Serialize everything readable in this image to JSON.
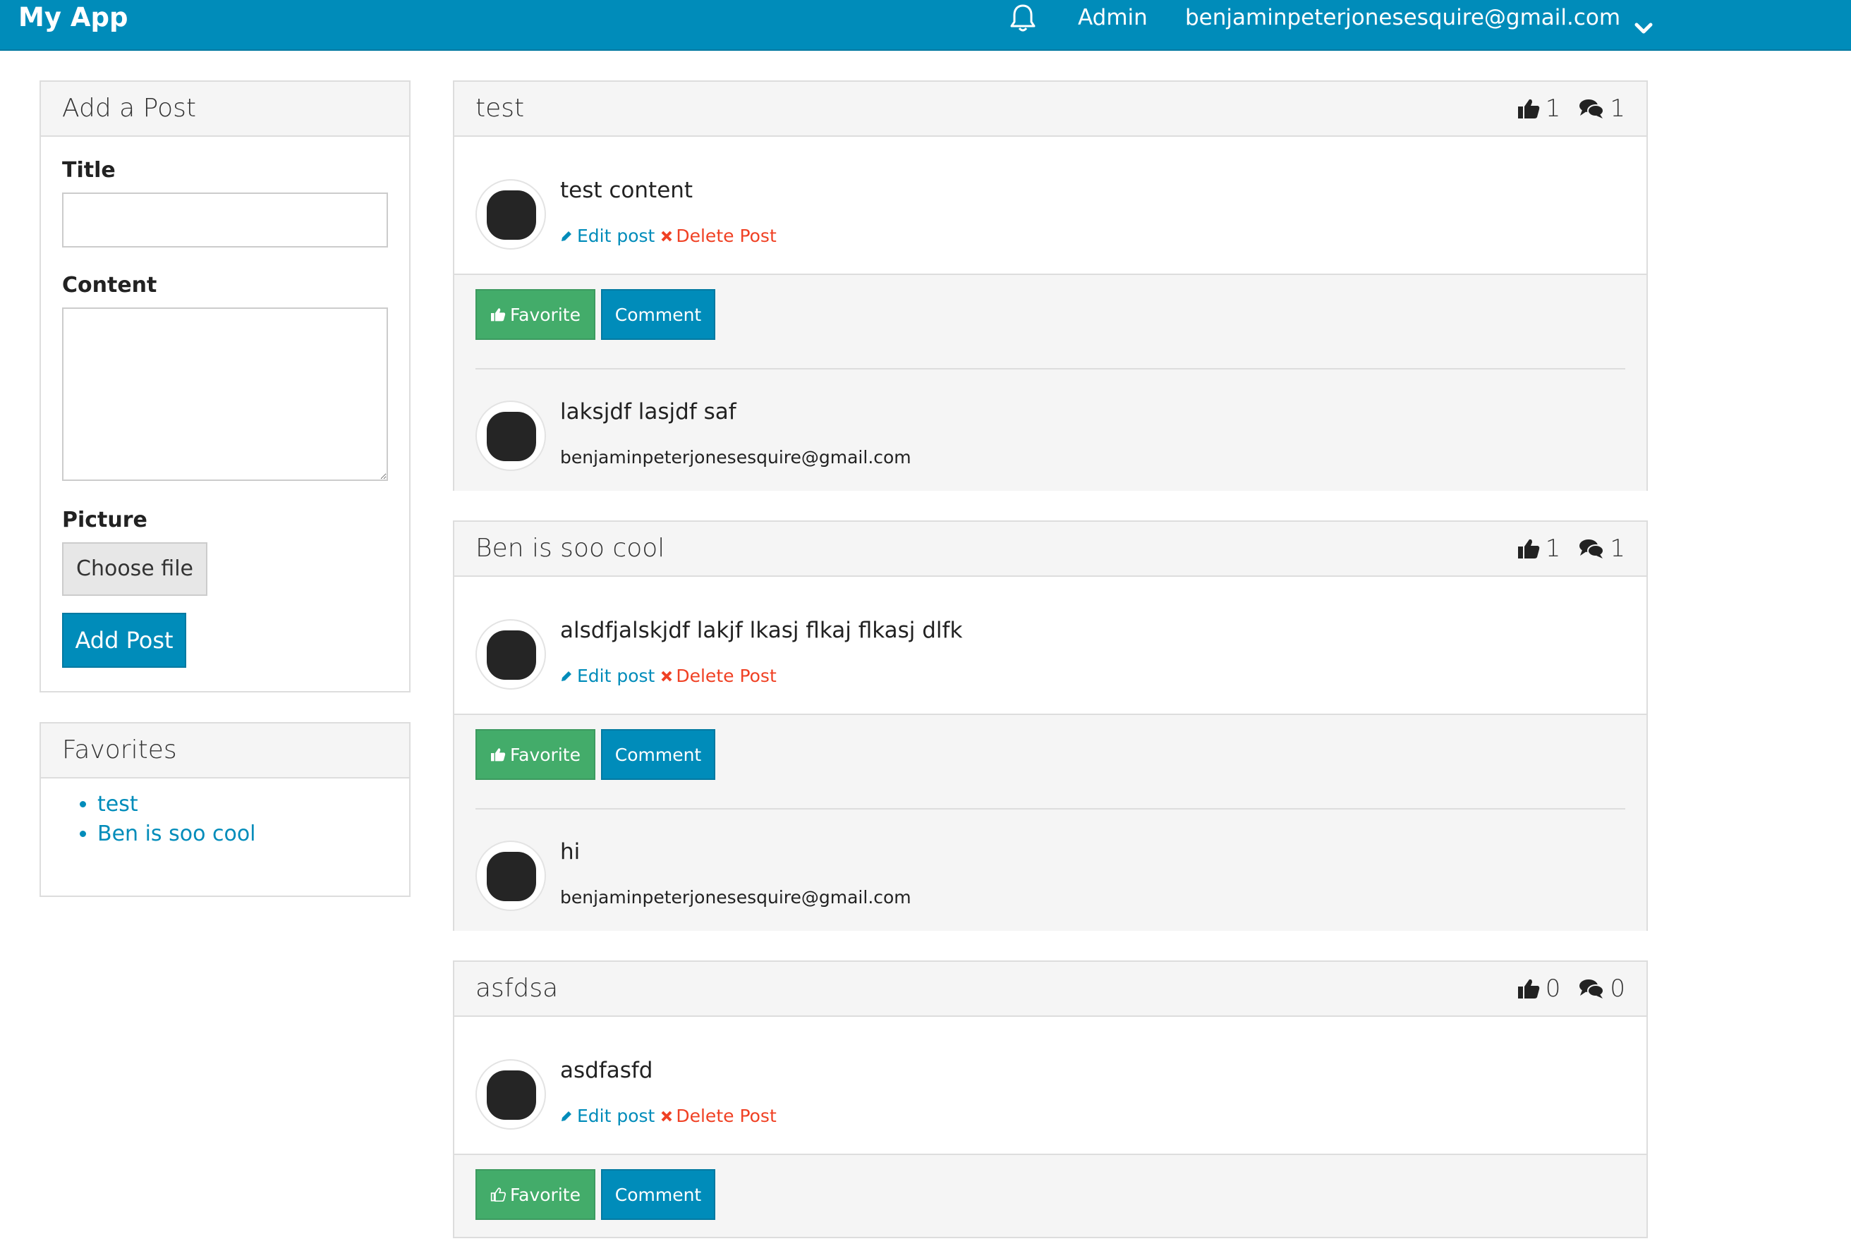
{
  "navbar": {
    "brand": "My App",
    "bell_icon": "bell-icon",
    "admin_label": "Admin",
    "user_email": "benjaminpeterjonesesquire@gmail.com",
    "caret_icon": "chevron-down-icon"
  },
  "add_post": {
    "heading": "Add a Post",
    "title_label": "Title",
    "title_value": "",
    "content_label": "Content",
    "content_value": "",
    "picture_label": "Picture",
    "choose_file_label": "Choose file",
    "submit_label": "Add Post"
  },
  "favorites": {
    "heading": "Favorites",
    "items": [
      "test",
      "Ben is soo cool"
    ]
  },
  "colors": {
    "primary": "#008cba",
    "success": "#43ac6a",
    "danger": "#f04124",
    "panel_heading_bg": "#f5f5f5"
  },
  "posts": [
    {
      "title": "test",
      "likes": "1",
      "comments_count": "1",
      "content": "test content",
      "edit_label": "Edit post",
      "delete_label": "Delete Post",
      "favorite_label": "Favorite",
      "favorited": true,
      "comment_label": "Comment",
      "comments": [
        {
          "text": "laksjdf lasjdf saf",
          "author": "benjaminpeterjonesesquire@gmail.com"
        }
      ]
    },
    {
      "title": "Ben is soo cool",
      "likes": "1",
      "comments_count": "1",
      "content": "alsdfjalskjdf lakjf lkasj flkaj flkasj dlfk",
      "edit_label": "Edit post",
      "delete_label": "Delete Post",
      "favorite_label": "Favorite",
      "favorited": true,
      "comment_label": "Comment",
      "comments": [
        {
          "text": "hi",
          "author": "benjaminpeterjonesesquire@gmail.com"
        }
      ]
    },
    {
      "title": "asfdsa",
      "likes": "0",
      "comments_count": "0",
      "content": "asdfasfd",
      "edit_label": "Edit post",
      "delete_label": "Delete Post",
      "favorite_label": "Favorite",
      "favorited": false,
      "comment_label": "Comment",
      "comments": []
    }
  ]
}
